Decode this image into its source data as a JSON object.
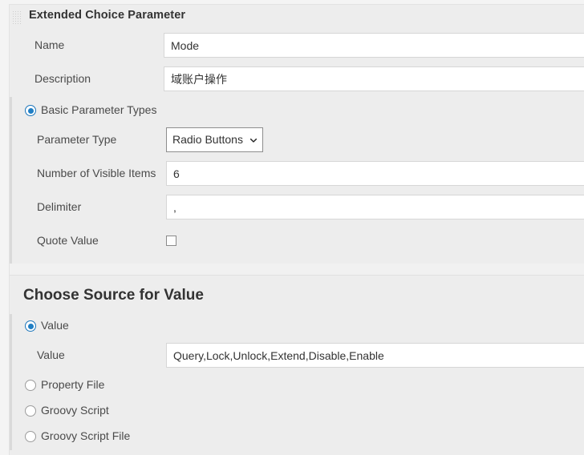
{
  "header": {
    "title": "Extended Choice Parameter",
    "drag_handle_icon": "drag-grip-icon"
  },
  "fields": {
    "name": {
      "label": "Name",
      "value": "Mode"
    },
    "description": {
      "label": "Description",
      "value": "域账户操作"
    }
  },
  "basic_section": {
    "radio_label": "Basic Parameter Types",
    "radio_selected": true,
    "parameter_type": {
      "label": "Parameter Type",
      "value": "Radio Buttons",
      "options": [
        "Radio Buttons"
      ],
      "chevron_icon": "chevron-down-icon"
    },
    "visible_items": {
      "label": "Number of Visible Items",
      "value": "6"
    },
    "delimiter": {
      "label": "Delimiter",
      "value": ","
    },
    "quote_value": {
      "label": "Quote Value",
      "checked": false
    }
  },
  "source_section": {
    "title": "Choose Source for Value",
    "options": [
      {
        "label": "Value",
        "selected": true
      },
      {
        "label": "Property File",
        "selected": false
      },
      {
        "label": "Groovy Script",
        "selected": false
      },
      {
        "label": "Groovy Script File",
        "selected": false
      }
    ],
    "value_field": {
      "label": "Value",
      "value": "Query,Lock,Unlock,Extend,Disable,Enable"
    }
  },
  "colors": {
    "accent": "#1f7ec4",
    "panel_bg": "#ededed",
    "page_bg": "#f4f4f4",
    "input_bg": "#ffffff",
    "text": "#333333"
  }
}
